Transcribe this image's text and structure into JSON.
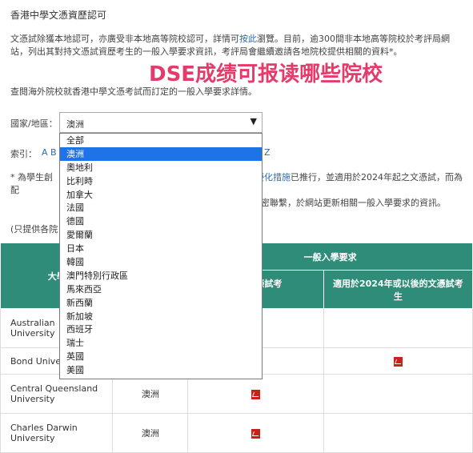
{
  "page": {
    "title": "香港中學文憑資歷認可",
    "intro_prefix": "文憑試除獲本地認可，亦廣受非本地高等院校認可，詳情可",
    "intro_link": "按此",
    "intro_suffix": "瀏覽。目前，逾300間非本地高等院校於考評局網站，列出其對持文憑試資歷考生的一般入學要求資訊，考評局會繼續邀請各地院校提供相關的資料*。",
    "overlay_text": "DSE成绩可报读哪些院校",
    "note": "查閱海外院校就香港中學文憑考試而訂定的一般入學要求詳情。",
    "region_label": "國家/地區：",
    "region_selected": "澳洲",
    "index_label": "索引：",
    "index_letters": "A B",
    "index_z": "Z",
    "footnote_prefix": "* 為學生創",
    "footnote_link": "優化措施",
    "footnote_mid": "已推行，並適用於2024年起之文憑試，而為配",
    "footnote_mid2": "教育院校緊密聯繫，於網站更新相關一般入學要求的資訊。",
    "footnote_end": "求的資訊。",
    "only_label": "(只提供各院"
  },
  "table": {
    "col_university": "大學",
    "col_general": "一般入學要求",
    "col_before": "前的文憑試考",
    "col_before2": "生",
    "col_after": "適用於2024年或以後的文憑試考生",
    "rows": [
      {
        "name": "Australian Catholic University",
        "name_visible": "Australian",
        "name_line2": "University",
        "country": "",
        "before_pdf": true,
        "after_pdf": false
      },
      {
        "name": "Bond University",
        "name_visible": "Bond Unive",
        "name_line2": "",
        "country": "",
        "before_pdf": true,
        "after_pdf": true
      },
      {
        "name": "Central Queensland University",
        "name_visible": "Central Queensland",
        "name_line2": "University",
        "country": "澳洲",
        "before_pdf": true,
        "after_pdf": false
      },
      {
        "name": "Charles Darwin University",
        "name_visible": "Charles Darwin",
        "name_line2": "University",
        "country": "澳洲",
        "before_pdf": true,
        "after_pdf": false
      }
    ]
  },
  "dropdown": {
    "selected_index": 1,
    "options": [
      "全部",
      "澳洲",
      "奧地利",
      "比利時",
      "加拿大",
      "法國",
      "德國",
      "愛爾蘭",
      "日本",
      "韓國",
      "澳門特別行政區",
      "馬來西亞",
      "新西蘭",
      "新加坡",
      "西班牙",
      "瑞士",
      "英國",
      "美國"
    ]
  },
  "colors": {
    "header_green": "#2f8c78",
    "overlay_pink": "#e53b6a",
    "link_blue": "#2b6cb0",
    "select_highlight": "#1e73e8",
    "pdf_red": "#c9201a"
  }
}
